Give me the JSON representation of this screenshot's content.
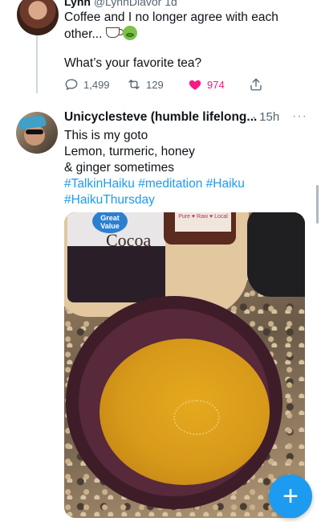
{
  "tweet1": {
    "name": "Lynn",
    "handle": "@LynnDiavor",
    "time": "1d",
    "text_line1": "Coffee and I no longer agree with each",
    "text_line2": "other...",
    "question": "What’s your favorite tea?",
    "replies": "1,499",
    "retweets": "129",
    "likes": "974"
  },
  "tweet2": {
    "name": "Unicyclesteve (humble lifelong...",
    "time": "· 15h",
    "more": "···",
    "lines": [
      "This is my goto",
      "Lemon, turmeric, honey",
      "& ginger sometimes"
    ],
    "hashtags_line1": [
      "#TalkinHaiku",
      "#meditation",
      "#Haiku"
    ],
    "hashtags_line2": [
      "#HaikuThursday"
    ]
  },
  "photo": {
    "brand": "Great Value",
    "product": "Cocoa",
    "jar_label": "Pure ♥ Raw ♥ Local"
  },
  "fab": {
    "icon": "plus"
  },
  "colors": {
    "accent": "#1d9bf0",
    "like": "#f91880",
    "muted": "#536471"
  }
}
